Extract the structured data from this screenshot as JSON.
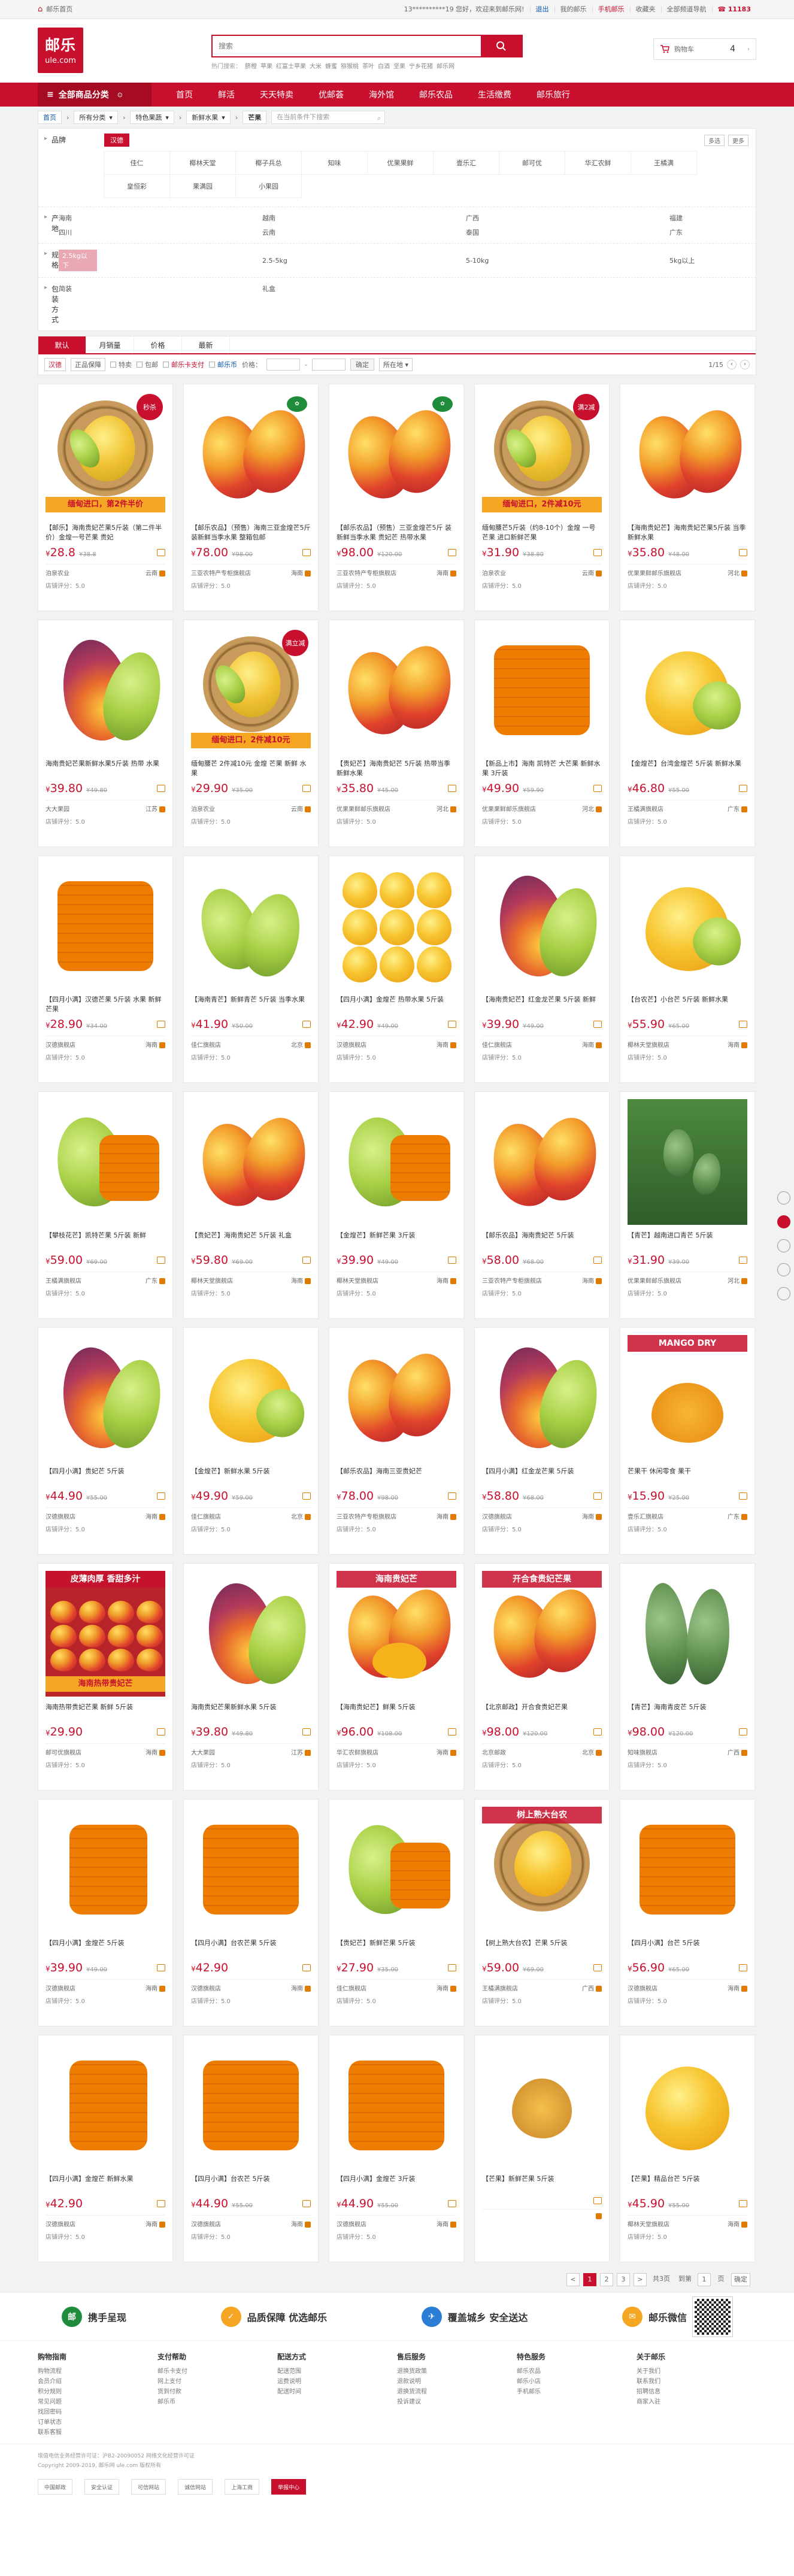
{
  "topbar": {
    "home": "邮乐首页",
    "welcome": "13**********19 您好，欢迎来到邮乐网!",
    "logout": "退出",
    "links": [
      "我的邮乐",
      "手机邮乐",
      "收藏夹",
      "全部频道导航"
    ],
    "hotline": "11183"
  },
  "header": {
    "logo_main": "邮乐",
    "logo_sub": "ule.com",
    "search_placeholder": "搜索",
    "hotwords": [
      "热门搜索：",
      "脐橙",
      "苹果",
      "红富士苹果",
      "大米",
      "蜂蜜",
      "猕猴桃",
      "茶叶",
      "白酒",
      "坚果",
      "宁乡花猪",
      "邮乐网"
    ],
    "cart_label": "购物车",
    "cart_count": "4"
  },
  "nav": {
    "allcat": "全部商品分类",
    "items": [
      "首页",
      "鲜活",
      "天天特卖",
      "优邮荟",
      "海外馆",
      "邮乐农品",
      "生活缴费",
      "邮乐旅行"
    ]
  },
  "crumb": {
    "items": [
      "首页",
      "所有分类",
      "特色果蔬",
      "新鲜水果"
    ],
    "current": "芒果",
    "search_placeholder": "在当前条件下搜索"
  },
  "filter": {
    "brand_label": "品牌",
    "brand_selected": "汉德",
    "multi": [
      "多选",
      "更多"
    ],
    "brands": [
      "佳仁",
      "椰林天堂",
      "椰子兵总",
      "知味",
      "优果果鲜",
      "壹乐汇",
      "邮可优",
      "华汇农鲜",
      "王橘满",
      "皇恒彩",
      "果满园",
      "小果园"
    ],
    "origin_label": "产地",
    "origins": [
      "海南",
      "越南",
      "广西",
      "福建",
      "四川",
      "云南",
      "泰国",
      "广东"
    ],
    "spec_label": "规格",
    "specs": [
      "2.5kg以下",
      "2.5-5kg",
      "5-10kg",
      "5kg以上"
    ],
    "pack_label": "包装方式",
    "packs": [
      "简装",
      "礼盒"
    ]
  },
  "sort": {
    "tabs": [
      "默认",
      "月销量",
      "价格",
      "最新"
    ],
    "chips": [
      "汉德",
      "正品保障"
    ],
    "checks": [
      "特卖",
      "包邮",
      "邮乐卡支付",
      "邮乐币"
    ],
    "price_label": "价格：",
    "ok": "确定",
    "area": "所在地",
    "page": "1/15"
  },
  "products": [
    {
      "name": "【邮乐】海南贵妃芒果5斤装（第二件半价）金煌一号芒果 贵妃",
      "price": "28.8",
      "old": "¥38.8",
      "shop": "泊泉农业",
      "loc": "云南",
      "rate": "店铺评分：5.0",
      "badge": "秒杀",
      "promo": "缅甸进口，第2件半价",
      "art": "basket"
    },
    {
      "name": "【邮乐农品】（预售）海南三亚金煌芒5斤 装新鲜当季水果 整箱包邮",
      "price": "78.00",
      "old": "¥98.00",
      "shop": "三亚农特产专柜旗舰店",
      "loc": "海南",
      "rate": "店铺评分：5.0",
      "badge": "green",
      "art": "red"
    },
    {
      "name": "【邮乐农品】（预售）三亚金煌芒5斤 装新鲜当季水果 贵妃芒 热带水果",
      "price": "98.00",
      "old": "¥120.00",
      "shop": "三亚农特产专柜旗舰店",
      "loc": "海南",
      "rate": "店铺评分：5.0",
      "badge": "green",
      "art": "red"
    },
    {
      "name": "缅甸腰芒5斤装（约8-10个）金煌 一号芒果 进口新鲜芒果",
      "price": "31.90",
      "old": "¥38.80",
      "shop": "泊泉农业",
      "loc": "云南",
      "rate": "店铺评分：5.0",
      "badge": "满2减",
      "promo": "缅甸进口，2件减10元",
      "art": "basket"
    },
    {
      "name": "【海南贵妃芒】海南贵妃芒果5斤装 当季新鲜水果",
      "price": "35.80",
      "old": "¥48.00",
      "shop": "优果果鲜邮乐旗舰店",
      "loc": "河北",
      "rate": "店铺评分：5.0",
      "art": "red"
    },
    {
      "name": "海南贵妃芒果新鲜水果5斤装 热带 水果",
      "price": "39.80",
      "old": "¥49.80",
      "shop": "大大果园",
      "loc": "江苏",
      "rate": "店铺评分：5.0",
      "art": "purple"
    },
    {
      "name": "缅甸腰芒 2件减10元 金煌 芒果 新鲜 水果",
      "price": "29.90",
      "old": "¥35.00",
      "shop": "泊泉农业",
      "loc": "云南",
      "rate": "店铺评分：5.0",
      "badge": "满立减",
      "promo": "缅甸进口，2件减10元",
      "art": "basket"
    },
    {
      "name": "【贵妃芒】海南贵妃芒 5斤装 热带当季新鲜水果",
      "price": "35.80",
      "old": "¥45.00",
      "shop": "优果果鲜邮乐旗舰店",
      "loc": "河北",
      "rate": "店铺评分：5.0",
      "art": "red"
    },
    {
      "name": "【新品上市】海南 凯特芒 大芒果 新鲜水果 3斤装",
      "price": "49.90",
      "old": "¥59.90",
      "shop": "优果果鲜邮乐旗舰店",
      "loc": "河北",
      "rate": "店铺评分：5.0",
      "art": "cube"
    },
    {
      "name": "【金煌芒】台湾金煌芒 5斤装 新鲜水果",
      "price": "46.80",
      "old": "¥55.00",
      "shop": "王橘满旗舰店",
      "loc": "广东",
      "rate": "店铺评分：5.0",
      "art": "yellow"
    },
    {
      "name": "【四月小满】汉德芒果 5斤装 水果 新鲜 芒果",
      "price": "28.90",
      "old": "¥34.00",
      "shop": "汉德旗舰店",
      "loc": "海南",
      "rate": "店铺评分：5.0",
      "art": "cube"
    },
    {
      "name": "【海南青芒】新鲜青芒 5斤装 当季水果",
      "price": "41.90",
      "old": "¥50.00",
      "shop": "佳仁旗舰店",
      "loc": "北京",
      "rate": "店铺评分：5.0",
      "art": "green"
    },
    {
      "name": "【四月小满】金煌芒 热带水果 5斤装",
      "price": "42.90",
      "old": "¥49.00",
      "shop": "汉德旗舰店",
      "loc": "海南",
      "rate": "店铺评分：5.0",
      "art": "boxed"
    },
    {
      "name": "【海南贵妃芒】红金龙芒果 5斤装 新鲜",
      "price": "39.90",
      "old": "¥49.00",
      "shop": "佳仁旗舰店",
      "loc": "海南",
      "rate": "店铺评分：5.0",
      "art": "purple"
    },
    {
      "name": "【台农芒】小台芒 5斤装 新鲜水果",
      "price": "55.90",
      "old": "¥65.00",
      "shop": "椰林天堂旗舰店",
      "loc": "海南",
      "rate": "店铺评分：5.0",
      "art": "yellow"
    },
    {
      "name": "【攀枝花芒】凯特芒果 5斤装 新鲜",
      "price": "59.00",
      "old": "¥69.00",
      "shop": "王橘满旗舰店",
      "loc": "广东",
      "rate": "店铺评分：5.0",
      "art": "greencut"
    },
    {
      "name": "【贵妃芒】海南贵妃芒 5斤装 礼盒",
      "price": "59.80",
      "old": "¥69.00",
      "shop": "椰林天堂旗舰店",
      "loc": "海南",
      "rate": "店铺评分：5.0",
      "art": "red"
    },
    {
      "name": "【金煌芒】新鲜芒果 3斤装",
      "price": "39.90",
      "old": "¥49.00",
      "shop": "椰林天堂旗舰店",
      "loc": "海南",
      "rate": "店铺评分：5.0",
      "art": "greencut"
    },
    {
      "name": "【邮乐农品】海南贵妃芒 5斤装",
      "price": "58.00",
      "old": "¥68.00",
      "shop": "三亚农特产专柜旗舰店",
      "loc": "海南",
      "rate": "店铺评分：5.0",
      "art": "red"
    },
    {
      "name": "【青芒】越南进口青芒 5斤装",
      "price": "31.90",
      "old": "¥39.00",
      "shop": "优果果鲜邮乐旗舰店",
      "loc": "河北",
      "rate": "店铺评分：5.0",
      "art": "tree"
    },
    {
      "name": "【四月小满】贵妃芒 5斤装",
      "price": "44.90",
      "old": "¥55.00",
      "shop": "汉德旗舰店",
      "loc": "海南",
      "rate": "店铺评分：5.0",
      "art": "purple"
    },
    {
      "name": "【金煌芒】新鲜水果 5斤装",
      "price": "49.90",
      "old": "¥59.00",
      "shop": "佳仁旗舰店",
      "loc": "北京",
      "rate": "店铺评分：5.0",
      "art": "yellow"
    },
    {
      "name": "【邮乐农品】海南三亚贵妃芒",
      "price": "78.00",
      "old": "¥98.00",
      "shop": "三亚农特产专柜旗舰店",
      "loc": "海南",
      "rate": "店铺评分：5.0",
      "art": "red"
    },
    {
      "name": "【四月小满】红金龙芒果 5斤装",
      "price": "58.80",
      "old": "¥68.00",
      "shop": "汉德旗舰店",
      "loc": "海南",
      "rate": "店铺评分：5.0",
      "art": "purple"
    },
    {
      "name": "芒果干 休闲零食 果干",
      "price": "15.90",
      "old": "¥25.00",
      "shop": "壹乐汇旗舰店",
      "loc": "广东",
      "rate": "店铺评分：5.0",
      "art": "dry",
      "promo_top": "MANGO DRY"
    },
    {
      "name": "海南热带贵妃芒果 新鲜 5斤装",
      "price": "29.90",
      "old": "",
      "shop": "邮可优旗舰店",
      "loc": "海南",
      "rate": "店铺评分：5.0",
      "art": "crate",
      "promo": "海南热带贵妃芒",
      "promo_top": "皮薄肉厚 香甜多汁"
    },
    {
      "name": "海南贵妃芒果新鲜水果 5斤装",
      "price": "39.80",
      "old": "¥49.80",
      "shop": "大大果园",
      "loc": "江苏",
      "rate": "店铺评分：5.0",
      "art": "purple"
    },
    {
      "name": "【海南贵妃芒】鲜果 5斤装",
      "price": "96.00",
      "old": "¥108.00",
      "shop": "华汇农鲜旗舰店",
      "loc": "海南",
      "rate": "店铺评分：5.0",
      "art": "redcut",
      "promo_top": "海南贵妃芒"
    },
    {
      "name": "【北京邮政】开合食贵妃芒果",
      "price": "98.00",
      "old": "¥120.00",
      "shop": "北京邮政",
      "loc": "北京",
      "rate": "店铺评分：5.0",
      "art": "red",
      "promo_top": "开合食贵妃芒果"
    },
    {
      "name": "【青芒】海南青皮芒 5斤装",
      "price": "98.00",
      "old": "¥120.00",
      "shop": "知味旗舰店",
      "loc": "广西",
      "rate": "店铺评分：5.0",
      "art": "darkgreen"
    },
    {
      "name": "【四月小满】金煌芒 5斤装",
      "price": "39.90",
      "old": "¥49.00",
      "shop": "汉德旗舰店",
      "loc": "海南",
      "rate": "店铺评分：5.0",
      "art": "cutyellow"
    },
    {
      "name": "【四月小满】台农芒果 5斤装",
      "price": "42.90",
      "old": "",
      "shop": "汉德旗舰店",
      "loc": "海南",
      "rate": "店铺评分：5.0",
      "art": "cube"
    },
    {
      "name": "【贵妃芒】新鲜芒果 5斤装",
      "price": "27.90",
      "old": "¥35.00",
      "shop": "佳仁旗舰店",
      "loc": "海南",
      "rate": "店铺评分：5.0",
      "art": "greencut"
    },
    {
      "name": "【树上熟大台农】芒果 5斤装",
      "price": "59.00",
      "old": "¥69.00",
      "shop": "王橘满旗舰店",
      "loc": "广西",
      "rate": "店铺评分：5.0",
      "art": "basket2",
      "promo_top": "树上熟大台农"
    },
    {
      "name": "【四月小满】台芒 5斤装",
      "price": "56.90",
      "old": "¥65.00",
      "shop": "汉德旗舰店",
      "loc": "海南",
      "rate": "店铺评分：5.0",
      "art": "cube"
    },
    {
      "name": "【四月小满】金煌芒 新鲜水果",
      "price": "42.90",
      "old": "",
      "shop": "汉德旗舰店",
      "loc": "海南",
      "rate": "店铺评分：5.0",
      "art": "cutyellow"
    },
    {
      "name": "【四月小满】台农芒 5斤装",
      "price": "44.90",
      "old": "¥55.00",
      "shop": "汉德旗舰店",
      "loc": "海南",
      "rate": "店铺评分：5.0",
      "art": "cube"
    },
    {
      "name": "【四月小满】金煌芒 3斤装",
      "price": "44.90",
      "old": "¥55.00",
      "shop": "汉德旗舰店",
      "loc": "海南",
      "rate": "店铺评分：5.0",
      "art": "cube"
    },
    {
      "name": "【芒果】新鲜芒果 5斤装",
      "price": "",
      "old": "",
      "shop": "",
      "loc": "",
      "rate": "",
      "art": "small"
    },
    {
      "name": "【芒果】精品台芒 5斤装",
      "price": "45.90",
      "old": "¥55.00",
      "shop": "椰林天堂旗舰店",
      "loc": "海南",
      "rate": "店铺评分：5.0",
      "art": "single"
    }
  ],
  "pager": {
    "pages": [
      "1",
      "2",
      "3"
    ],
    "prev": "<",
    "next": ">",
    "total": "共3页",
    "goto": "到第",
    "unit": "页",
    "ok": "确定"
  },
  "footer": {
    "services": [
      "携手呈现",
      "品质保障 优选邮乐",
      "覆盖城乡 安全送达",
      "邮乐微信"
    ],
    "cols": [
      {
        "title": "购物指南",
        "items": [
          "购物流程",
          "会员介绍",
          "积分规则",
          "常见问题",
          "找回密码",
          "订单状态",
          "联系客服"
        ]
      },
      {
        "title": "支付帮助",
        "items": [
          "邮乐卡支付",
          "网上支付",
          "货到付款",
          "邮乐币"
        ]
      },
      {
        "title": "配送方式",
        "items": [
          "配送范围",
          "运费说明",
          "配送时间"
        ]
      },
      {
        "title": "售后服务",
        "items": [
          "退换货政策",
          "退款说明",
          "退换货流程",
          "投诉建议"
        ]
      },
      {
        "title": "特色服务",
        "items": [
          "邮乐农品",
          "邮乐小店",
          "手机邮乐"
        ]
      },
      {
        "title": "关于邮乐",
        "items": [
          "关于我们",
          "联系我们",
          "招聘信息",
          "商家入驻"
        ]
      }
    ],
    "copyright": [
      "增值电信业务经营许可证：沪B2-20090052  网络文化经营许可证",
      "Copyright 2009-2019, 邮乐网 ule.com 版权所有"
    ],
    "certs": [
      "中国邮政",
      "安全认证",
      "可信网站",
      "诚信网站",
      "上海工商",
      "举报中心"
    ]
  }
}
